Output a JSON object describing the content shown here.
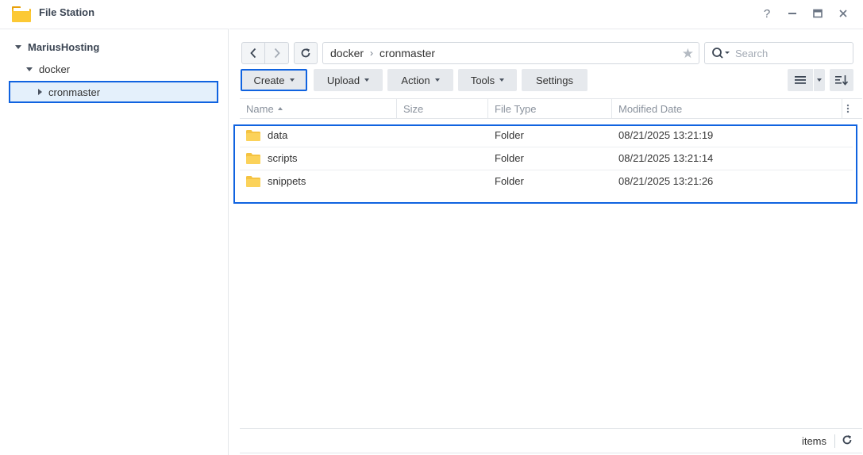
{
  "window": {
    "title": "File Station",
    "help_label": "?",
    "minimize_label": "—",
    "maximize_label": "▭",
    "close_label": "✕"
  },
  "sidebar": {
    "items": [
      {
        "label": "MariusHosting",
        "level": 0,
        "expanded": true
      },
      {
        "label": "docker",
        "level": 1,
        "expanded": true
      },
      {
        "label": "cronmaster",
        "level": 2,
        "expanded": false,
        "selected": true
      }
    ]
  },
  "path": {
    "segments": [
      "docker",
      "cronmaster"
    ]
  },
  "search": {
    "placeholder": "Search",
    "value": ""
  },
  "toolbar": {
    "create_label": "Create",
    "upload_label": "Upload",
    "action_label": "Action",
    "tools_label": "Tools",
    "settings_label": "Settings"
  },
  "columns": {
    "name": "Name",
    "size": "Size",
    "file_type": "File Type",
    "modified_date": "Modified Date"
  },
  "files": [
    {
      "name": "data",
      "size": "",
      "type": "Folder",
      "modified": "08/21/2025 13:21:19"
    },
    {
      "name": "scripts",
      "size": "",
      "type": "Folder",
      "modified": "08/21/2025 13:21:14"
    },
    {
      "name": "snippets",
      "size": "",
      "type": "Folder",
      "modified": "08/21/2025 13:21:26"
    }
  ],
  "footer": {
    "items_label": "items"
  },
  "colors": {
    "highlight": "#1063e0",
    "folder": "#f5c342",
    "selected_bg": "#e4f0fb"
  }
}
